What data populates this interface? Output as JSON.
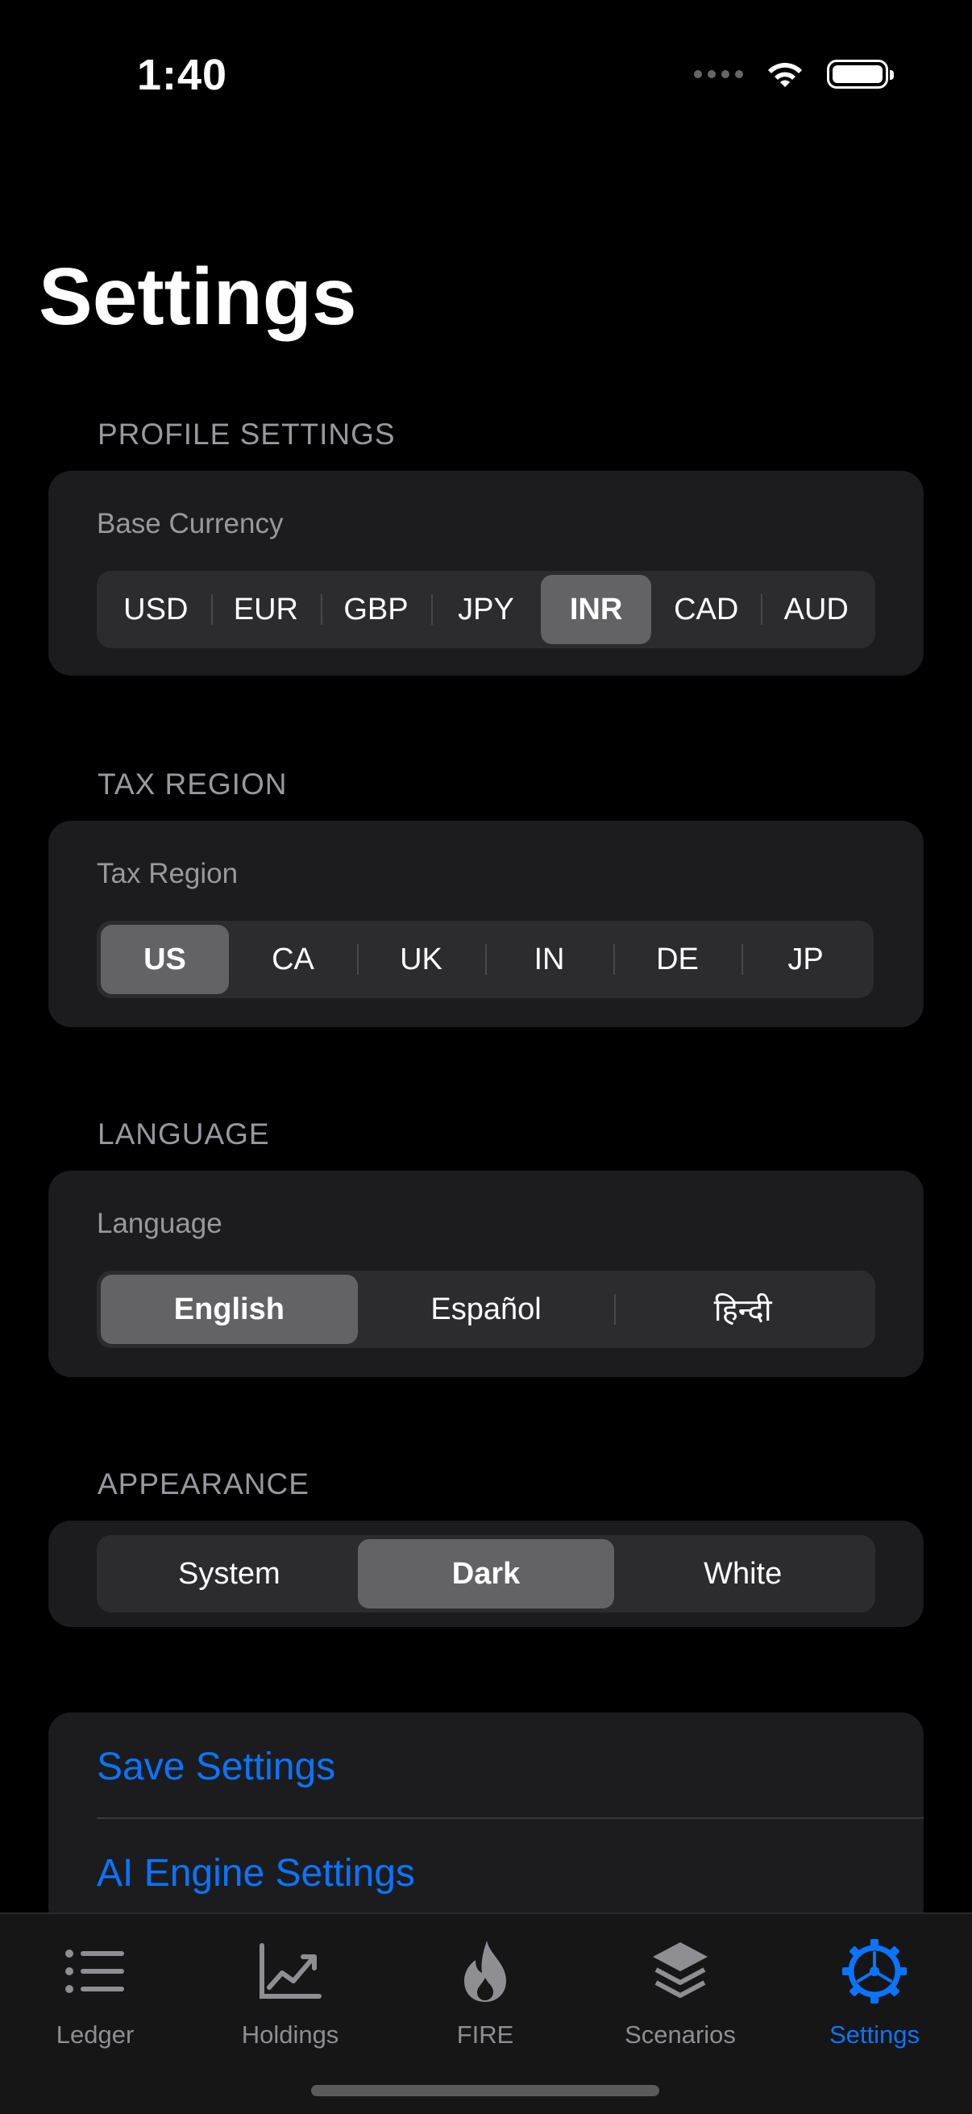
{
  "status_bar": {
    "time": "1:40"
  },
  "page_title": "Settings",
  "profile": {
    "header": "PROFILE SETTINGS",
    "label": "Base Currency",
    "options": [
      "USD",
      "EUR",
      "GBP",
      "JPY",
      "INR",
      "CAD",
      "AUD"
    ],
    "selected": "INR"
  },
  "tax": {
    "header": "TAX REGION",
    "label": "Tax Region",
    "options": [
      "US",
      "CA",
      "UK",
      "IN",
      "DE",
      "JP"
    ],
    "selected": "US"
  },
  "language": {
    "header": "LANGUAGE",
    "label": "Language",
    "options": [
      "English",
      "Español",
      "हिन्दी"
    ],
    "selected": "English"
  },
  "appearance": {
    "header": "APPEARANCE",
    "options": [
      "System",
      "Dark",
      "White"
    ],
    "selected": "Dark"
  },
  "actions": {
    "save": "Save Settings",
    "ai_engine": "AI Engine Settings"
  },
  "tabbar": {
    "items": [
      {
        "label": "Ledger",
        "icon": "list-icon"
      },
      {
        "label": "Holdings",
        "icon": "chart-icon"
      },
      {
        "label": "FIRE",
        "icon": "flame-icon"
      },
      {
        "label": "Scenarios",
        "icon": "layers-icon"
      },
      {
        "label": "Settings",
        "icon": "gear-icon"
      }
    ],
    "active": "Settings"
  },
  "colors": {
    "accent": "#0A74FF",
    "background": "#000000",
    "card": "#1C1C1E",
    "segment_bg": "#2C2C2E",
    "segment_selected": "#636366",
    "secondary_text": "#98989E"
  }
}
